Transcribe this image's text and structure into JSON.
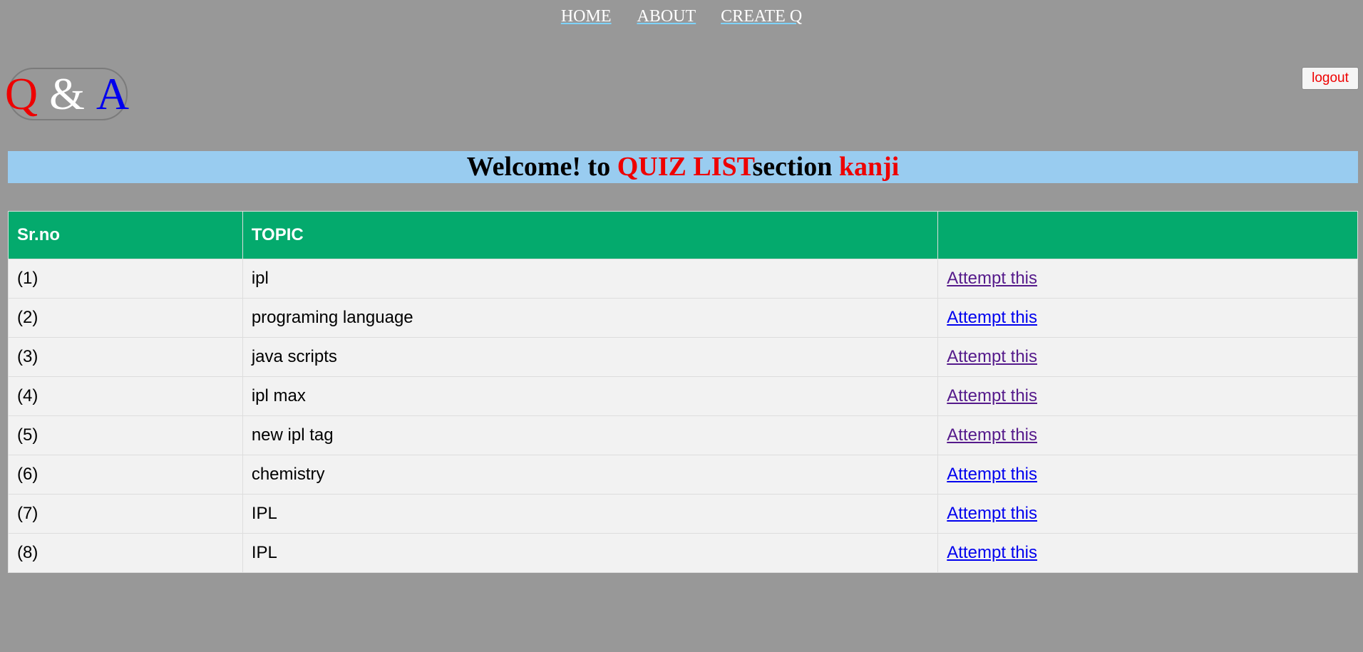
{
  "nav": {
    "home": "HOME",
    "about": "ABOUT",
    "create": "CREATE Q"
  },
  "logo": {
    "q": "Q",
    "amp": "&",
    "a": "A"
  },
  "logout_label": "logout",
  "welcome": {
    "prefix": "Welcome! to ",
    "highlight": "QUIZ LIST",
    "middle": "section ",
    "user": "kanji"
  },
  "table": {
    "headers": [
      "Sr.no",
      "TOPIC",
      ""
    ],
    "rows": [
      {
        "sr": "(1)",
        "topic": "ipl",
        "action": "Attempt this",
        "visited": true
      },
      {
        "sr": "(2)",
        "topic": "programing language",
        "action": "Attempt this",
        "visited": false
      },
      {
        "sr": "(3)",
        "topic": "java scripts",
        "action": "Attempt this",
        "visited": true
      },
      {
        "sr": "(4)",
        "topic": "ipl max",
        "action": "Attempt this",
        "visited": true
      },
      {
        "sr": "(5)",
        "topic": "new ipl tag",
        "action": "Attempt this",
        "visited": true
      },
      {
        "sr": "(6)",
        "topic": "chemistry",
        "action": "Attempt this",
        "visited": false
      },
      {
        "sr": "(7)",
        "topic": "IPL",
        "action": "Attempt this",
        "visited": false
      },
      {
        "sr": "(8)",
        "topic": "IPL",
        "action": "Attempt this",
        "visited": false
      }
    ]
  },
  "colors": {
    "background": "#989898",
    "banner": "#99ccf0",
    "header_green": "#04aa6d",
    "accent_red": "#ee0000",
    "link_blue": "#0000ee",
    "link_visited": "#551a8b"
  }
}
